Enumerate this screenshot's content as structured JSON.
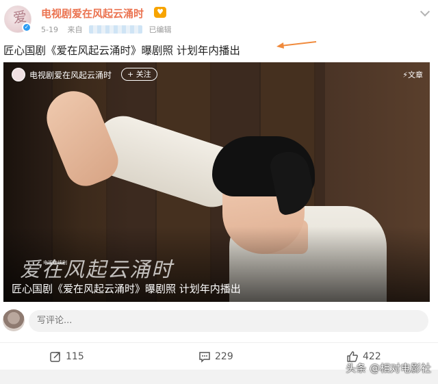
{
  "header": {
    "username": "电视剧爱在风起云涌时",
    "date": "5-19",
    "source_prefix": "来自",
    "edited": "已编辑"
  },
  "post": {
    "text": "匠心国剧《爱在风起云涌时》曝剧照 计划年内播出"
  },
  "media": {
    "account_name": "电视剧爱在风起云涌时",
    "follow_label": "+ 关注",
    "article_tag": "⚡文章",
    "calligraphy_small": "电视连续剧",
    "caption": "匠心国剧《爱在风起云涌时》曝剧照 计划年内播出"
  },
  "comment": {
    "placeholder": "写评论..."
  },
  "actions": {
    "share_count": "115",
    "comment_count": "229",
    "like_count": "422"
  },
  "watermark": "头条 @相对电影社",
  "colors": {
    "username": "#eb7350",
    "arrow": "#f08a3c",
    "verified": "#2d9cf2"
  }
}
